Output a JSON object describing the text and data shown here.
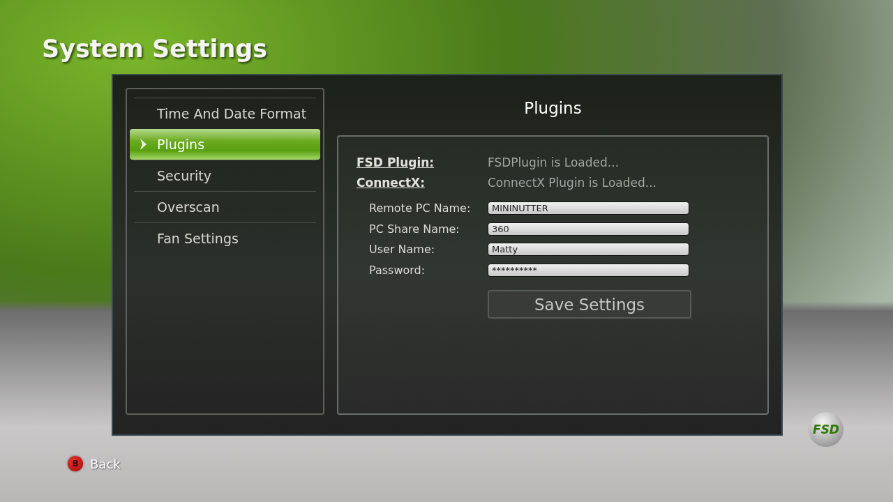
{
  "page_title": "System Settings",
  "menu": [
    {
      "label": "Time And Date Format",
      "selected": false
    },
    {
      "label": "Plugins",
      "selected": true
    },
    {
      "label": "Security",
      "selected": false
    },
    {
      "label": "Overscan",
      "selected": false
    },
    {
      "label": "Fan Settings",
      "selected": false
    }
  ],
  "panel_title": "Plugins",
  "plugins": [
    {
      "label": "FSD Plugin:",
      "status": "FSDPlugin is Loaded..."
    },
    {
      "label": "ConnectX:",
      "status": "ConnectX Plugin is Loaded..."
    }
  ],
  "fields": [
    {
      "label": "Remote PC Name:",
      "value": "MININUTTER"
    },
    {
      "label": "PC Share Name:",
      "value": "360"
    },
    {
      "label": "User Name:",
      "value": "Matty"
    },
    {
      "label": "Password:",
      "value": "**********"
    }
  ],
  "save_button": "Save Settings",
  "back": {
    "key": "B",
    "label": "Back"
  },
  "logo_text": "FSD"
}
